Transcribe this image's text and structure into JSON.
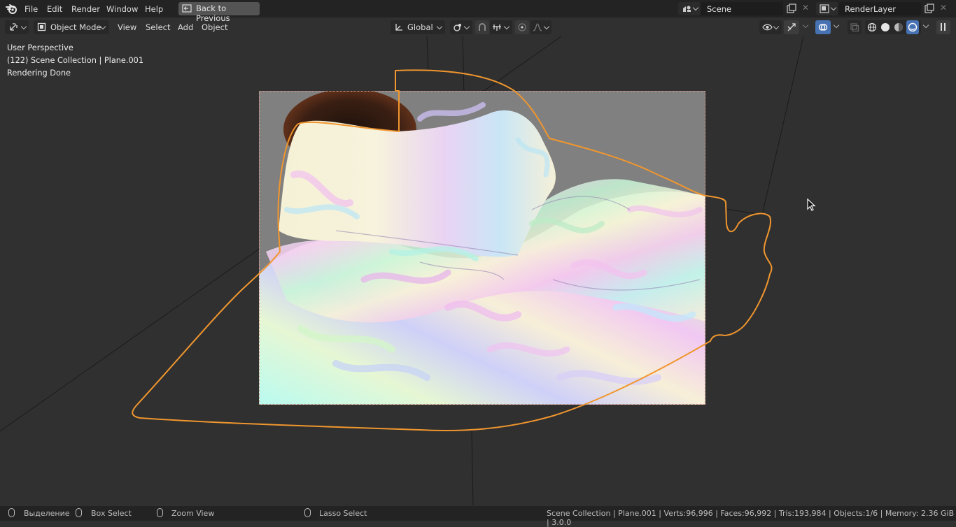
{
  "topbar": {
    "menu": [
      "File",
      "Edit",
      "Render",
      "Window",
      "Help"
    ],
    "back_button": "Back to Previous",
    "scene": "Scene",
    "render_layer": "RenderLayer"
  },
  "header": {
    "mode": "Object Mode",
    "menus": [
      "View",
      "Select",
      "Add",
      "Object"
    ],
    "orientation": "Global"
  },
  "overlay": {
    "line1": "User Perspective",
    "line2": "(122) Scene Collection | Plane.001",
    "line3": "Rendering Done"
  },
  "status": {
    "select_label": "Выделение",
    "box_select": "Box Select",
    "zoom_view": "Zoom View",
    "lasso_select": "Lasso Select",
    "info": "Scene Collection | Plane.001 | Verts:96,996 | Faces:96,992 | Tris:193,984 | Objects:1/6 | Memory: 2.36 GiB | 3.0.0"
  },
  "colors": {
    "selection_outline": "#f0962e",
    "active_shading": "#4772b3"
  }
}
